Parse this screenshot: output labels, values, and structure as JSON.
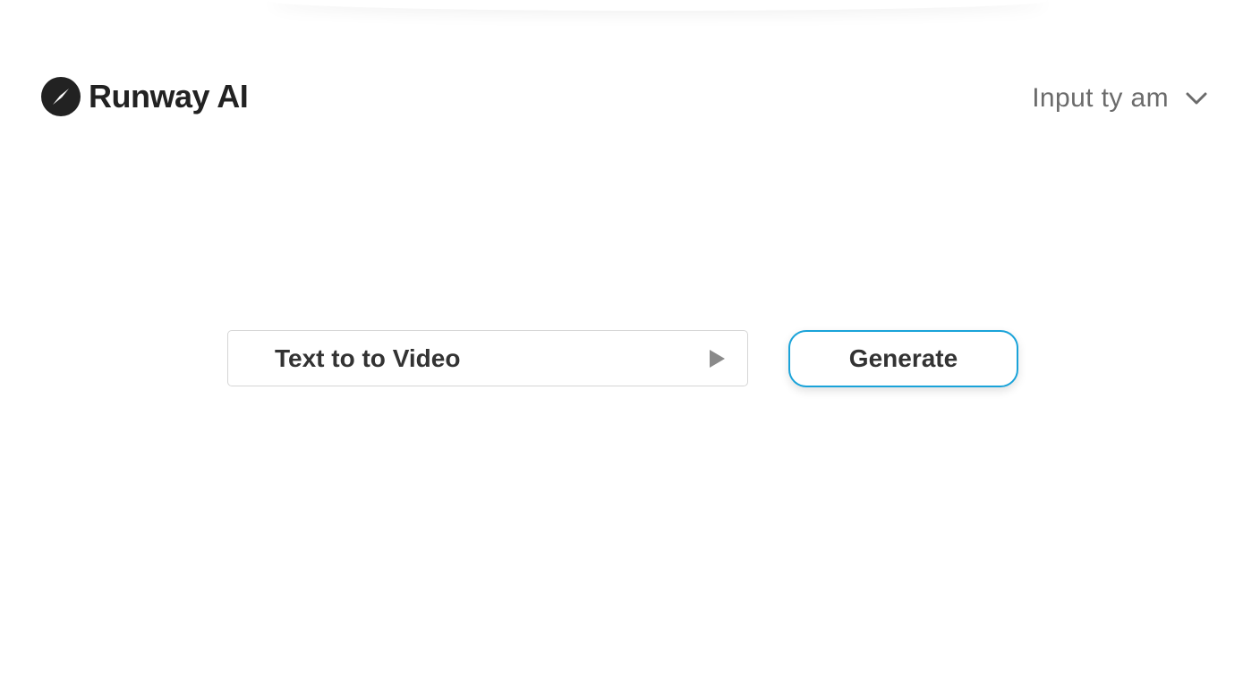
{
  "brand": {
    "name": "Runway AI",
    "logo_icon": "compass-icon",
    "logo_color": "#222222"
  },
  "input_type": {
    "label": "Input ty am",
    "icon": "chevron-down-icon"
  },
  "prompt": {
    "value": "Text to to Video",
    "icon": "play-icon"
  },
  "actions": {
    "generate_label": "Generate",
    "accent_color": "#1aa3d9"
  }
}
